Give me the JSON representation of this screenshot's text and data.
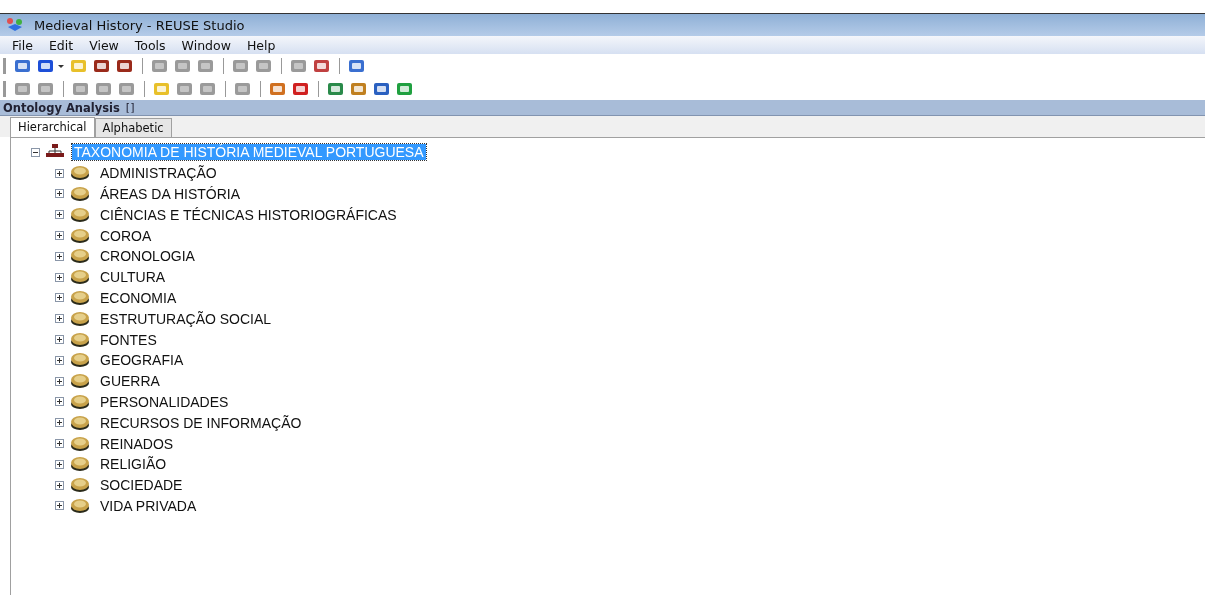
{
  "window": {
    "title": "Medieval History - REUSE Studio"
  },
  "menu": [
    "File",
    "Edit",
    "View",
    "Tools",
    "Window",
    "Help"
  ],
  "toolbars": [
    {
      "items": [
        {
          "kind": "button",
          "disabled": false
        },
        {
          "kind": "dropdown",
          "disabled": false
        },
        {
          "kind": "button",
          "disabled": false
        },
        {
          "kind": "button",
          "disabled": false
        },
        {
          "kind": "button",
          "disabled": false
        },
        {
          "kind": "separator"
        },
        {
          "kind": "button",
          "disabled": true
        },
        {
          "kind": "button",
          "disabled": true
        },
        {
          "kind": "button",
          "disabled": true
        },
        {
          "kind": "separator"
        },
        {
          "kind": "button",
          "disabled": true
        },
        {
          "kind": "button",
          "disabled": true
        },
        {
          "kind": "separator"
        },
        {
          "kind": "button",
          "disabled": true
        },
        {
          "kind": "button",
          "disabled": false
        },
        {
          "kind": "separator"
        },
        {
          "kind": "button",
          "disabled": false
        }
      ]
    },
    {
      "items": [
        {
          "kind": "button",
          "disabled": true
        },
        {
          "kind": "button",
          "disabled": true
        },
        {
          "kind": "separator"
        },
        {
          "kind": "button",
          "disabled": true
        },
        {
          "kind": "button",
          "disabled": true
        },
        {
          "kind": "button",
          "disabled": true
        },
        {
          "kind": "separator"
        },
        {
          "kind": "button",
          "disabled": false
        },
        {
          "kind": "button",
          "disabled": true
        },
        {
          "kind": "button",
          "disabled": true
        },
        {
          "kind": "separator"
        },
        {
          "kind": "button",
          "disabled": true
        },
        {
          "kind": "separator"
        },
        {
          "kind": "button",
          "disabled": false
        },
        {
          "kind": "button",
          "disabled": false
        },
        {
          "kind": "separator"
        },
        {
          "kind": "button",
          "disabled": false
        },
        {
          "kind": "button",
          "disabled": false
        },
        {
          "kind": "button",
          "disabled": false
        },
        {
          "kind": "button",
          "disabled": false
        }
      ]
    }
  ],
  "panel": {
    "title": "Ontology Analysis",
    "pin": "[]"
  },
  "tabs": [
    {
      "label": "Hierarchical",
      "selected": true
    },
    {
      "label": "Alphabetic",
      "selected": false
    }
  ],
  "tree": [
    {
      "label": "TAXONOMIA DE HISTÓRIA MEDIEVAL PORTUGUESA",
      "kind": "root",
      "expanded": true,
      "selected": true,
      "children": [
        {
          "label": "ADMINISTRAÇÃO",
          "kind": "class",
          "expanded": false,
          "selected": false
        },
        {
          "label": "ÁREAS DA HISTÓRIA",
          "kind": "class",
          "expanded": false,
          "selected": false
        },
        {
          "label": "CIÊNCIAS E TÉCNICAS HISTORIOGRÁFICAS",
          "kind": "class",
          "expanded": false,
          "selected": false
        },
        {
          "label": "COROA",
          "kind": "class",
          "expanded": false,
          "selected": false
        },
        {
          "label": "CRONOLOGIA",
          "kind": "class",
          "expanded": false,
          "selected": false
        },
        {
          "label": "CULTURA",
          "kind": "class",
          "expanded": false,
          "selected": false
        },
        {
          "label": "ECONOMIA",
          "kind": "class",
          "expanded": false,
          "selected": false
        },
        {
          "label": "ESTRUTURAÇÃO SOCIAL",
          "kind": "class",
          "expanded": false,
          "selected": false
        },
        {
          "label": "FONTES",
          "kind": "class",
          "expanded": false,
          "selected": false
        },
        {
          "label": "GEOGRAFIA",
          "kind": "class",
          "expanded": false,
          "selected": false
        },
        {
          "label": "GUERRA",
          "kind": "class",
          "expanded": false,
          "selected": false
        },
        {
          "label": "PERSONALIDADES",
          "kind": "class",
          "expanded": false,
          "selected": false
        },
        {
          "label": "RECURSOS DE INFORMAÇÃO",
          "kind": "class",
          "expanded": false,
          "selected": false
        },
        {
          "label": "REINADOS",
          "kind": "class",
          "expanded": false,
          "selected": false
        },
        {
          "label": "RELIGIÃO",
          "kind": "class",
          "expanded": false,
          "selected": false
        },
        {
          "label": "SOCIEDADE",
          "kind": "class",
          "expanded": false,
          "selected": false
        },
        {
          "label": "VIDA PRIVADA",
          "kind": "class",
          "expanded": false,
          "selected": false
        }
      ]
    }
  ]
}
